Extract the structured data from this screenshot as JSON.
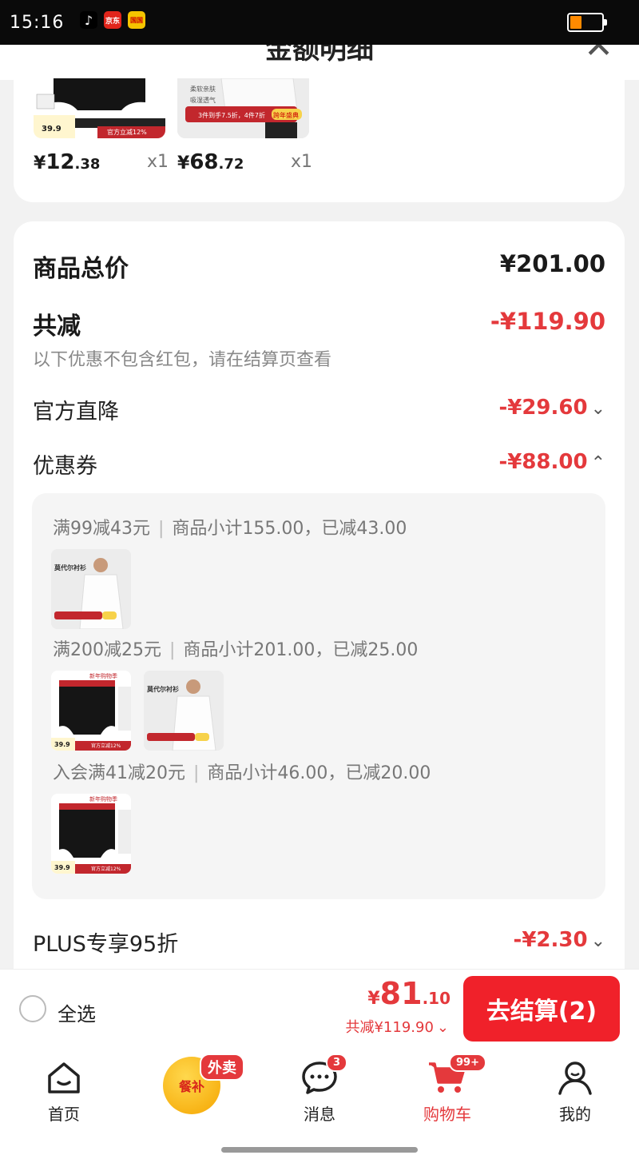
{
  "status_bar": {
    "time": "15:16",
    "apps": [
      "tiktok-icon",
      "jd-icon",
      "g-icon"
    ],
    "jd_label": "京东",
    "g_label": "国国"
  },
  "header": {
    "title": "金额明细"
  },
  "top_products": [
    {
      "price_yen": "¥",
      "price_int": "12",
      "price_dec": ".38",
      "qty": "x1",
      "img_price": "39.9",
      "img_tag": "官方立减12%"
    },
    {
      "price_yen": "¥",
      "price_int": "68",
      "price_dec": ".72",
      "qty": "x1",
      "img_tag": "3件到手7.5折，4件7折",
      "img_badge": "跨年盛典",
      "img_feat1": "柔软亲肤",
      "img_feat2": "吸湿透气"
    }
  ],
  "summary": {
    "goods_total_label": "商品总价",
    "goods_total_value": "¥201.00",
    "discount_label": "共减",
    "discount_value": "-¥119.90",
    "discount_note": "以下优惠不包含红包，请在结算页查看",
    "official_label": "官方直降",
    "official_value": "-¥29.60",
    "coupon_label": "优惠券",
    "coupon_value": "-¥88.00",
    "plus_label": "PLUS专享95折",
    "plus_value": "-¥2.30"
  },
  "coupons": [
    {
      "rule": "满99减43元",
      "detail": "商品小计155.00，已减43.00"
    },
    {
      "rule": "满200减25元",
      "detail": "商品小计201.00，已减25.00"
    },
    {
      "rule": "入会满41减20元",
      "detail": "商品小计46.00，已减20.00"
    }
  ],
  "thumbs": {
    "shirt_title": "莫代尔衬衫",
    "underwear_banner": "新年购物季",
    "underwear_price": "39.9",
    "underwear_tag": "官方立减12%"
  },
  "checkout": {
    "select_all": "全选",
    "total_yen": "¥",
    "total_int": "81",
    "total_dec": ".10",
    "total_save": "共减¥119.90",
    "pay_button": "去结算(2)"
  },
  "tabbar": {
    "home": "首页",
    "meal": "餐补",
    "meal_tag": "外卖",
    "messages": "消息",
    "messages_badge": "3",
    "cart": "购物车",
    "cart_badge": "99+",
    "me": "我的"
  },
  "colors": {
    "accent": "#e4393c",
    "pay_button": "#f0212a"
  }
}
